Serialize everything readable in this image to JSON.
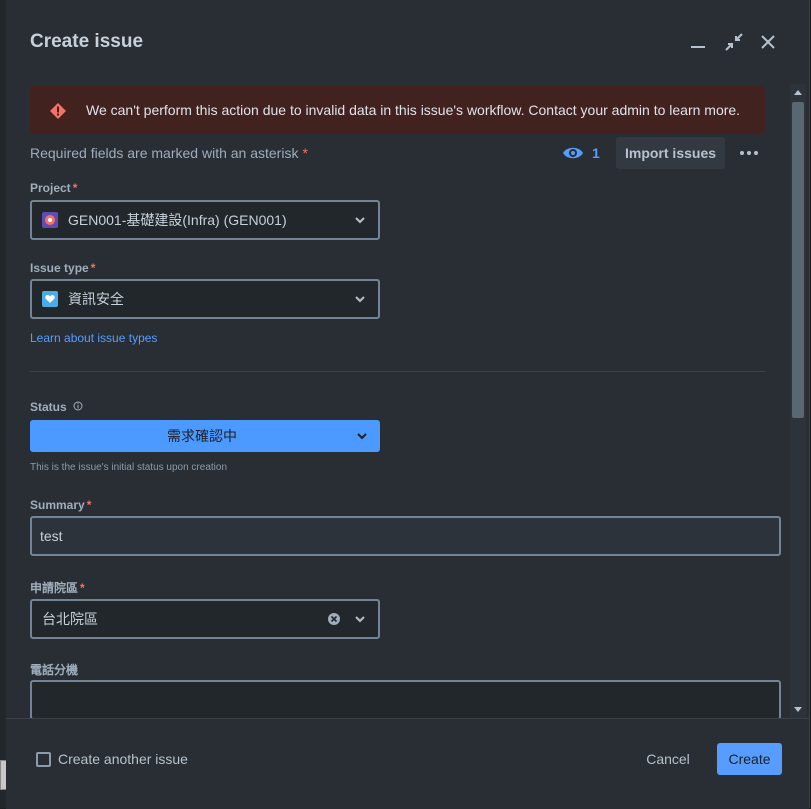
{
  "dialog": {
    "title": "Create issue",
    "icons": {
      "minimize": "minimize-icon",
      "collapse": "collapse-icon",
      "close": "close-icon"
    }
  },
  "error": {
    "message": "We can't perform this action due to invalid data in this issue's workflow. Contact your admin to learn more.",
    "icon": "error-icon",
    "color": "#42221f"
  },
  "toolbar": {
    "required_note": "Required fields are marked with an asterisk",
    "asterisk": "*",
    "watch_count": "1",
    "import_label": "Import issues"
  },
  "fields": {
    "project": {
      "label": "Project",
      "value": "GEN001-基礎建設(Infra) (GEN001)"
    },
    "issue_type": {
      "label": "Issue type",
      "value": "資訊安全"
    },
    "learn_link": "Learn about issue types",
    "status": {
      "label": "Status",
      "value": "需求確認中",
      "helper": "This is the issue's initial status upon creation",
      "color": "#4c9aff"
    },
    "summary": {
      "label": "Summary",
      "value": "test"
    },
    "campus": {
      "label": "申請院區",
      "value": "台北院區"
    },
    "extension": {
      "label": "電話分機",
      "value": ""
    }
  },
  "footer": {
    "create_another": "Create another issue",
    "cancel": "Cancel",
    "create": "Create"
  },
  "colors": {
    "accent": "#579dff",
    "background": "#282e33",
    "required": "#f87168"
  }
}
